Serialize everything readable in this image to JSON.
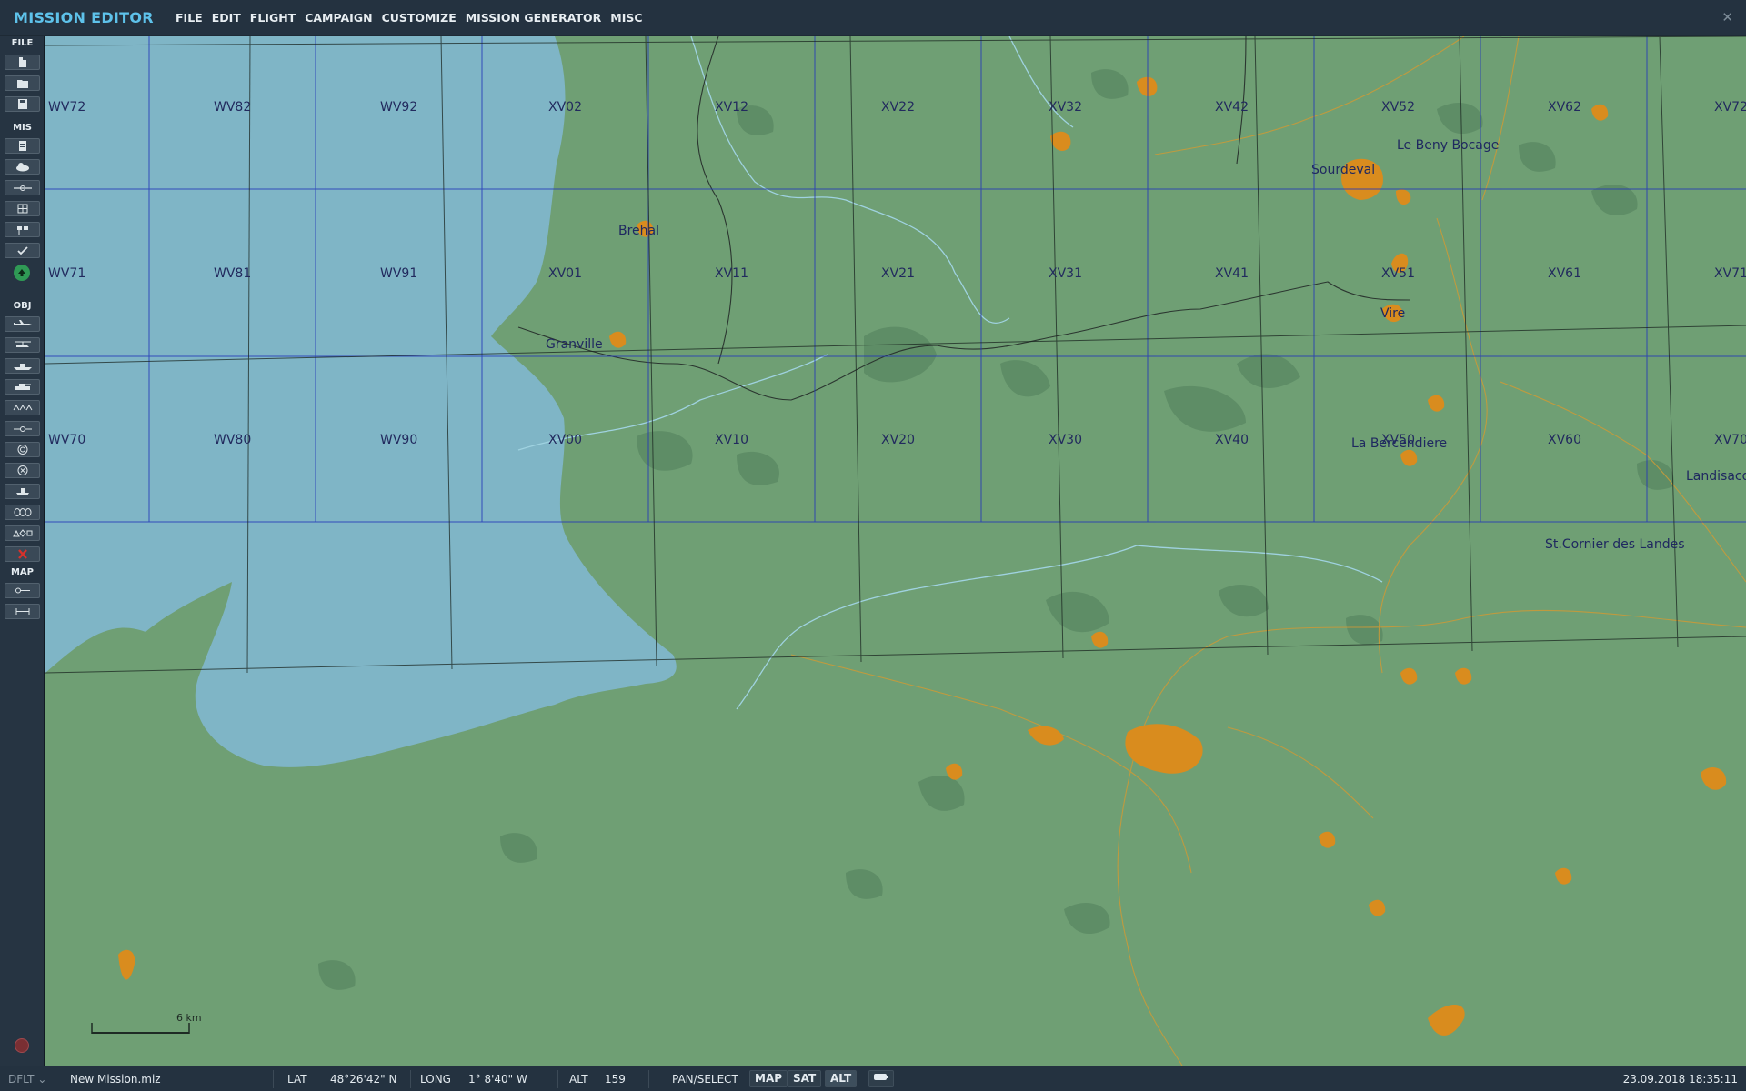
{
  "app": {
    "title": "MISSION EDITOR",
    "menu": [
      "FILE",
      "EDIT",
      "FLIGHT",
      "CAMPAIGN",
      "CUSTOMIZE",
      "MISSION GENERATOR",
      "MISC"
    ],
    "close_icon": "close-icon"
  },
  "sidebar": {
    "sections": {
      "file": "FILE",
      "mis": "MIS",
      "obj": "OBJ",
      "map": "MAP"
    },
    "file_buttons": [
      "new-file-icon",
      "open-file-icon",
      "save-file-icon"
    ],
    "mis_buttons": [
      "briefing-icon",
      "weather-icon",
      "trigger-zone-icon",
      "triggers-icon",
      "goals-icon",
      "check-icon",
      "go-icon"
    ],
    "obj_buttons": [
      "airplane-icon",
      "helicopter-icon",
      "ship-icon",
      "ground-unit-icon",
      "template-icon",
      "waypoint-icon",
      "target-icon",
      "static-object-icon",
      "cargo-icon",
      "zones-icon",
      "shapes-icon",
      "delete-icon"
    ],
    "map_buttons": [
      "map-options-icon",
      "ruler-icon"
    ]
  },
  "map": {
    "grid_labels": [
      [
        "WV72",
        "WV82",
        "WV92",
        "XV02",
        "XV12",
        "XV22",
        "XV32",
        "XV42",
        "XV52",
        "XV62",
        "XV72"
      ],
      [
        "WV71",
        "WV81",
        "WV91",
        "XV01",
        "XV11",
        "XV21",
        "XV31",
        "XV41",
        "XV51",
        "XV61",
        "XV71"
      ],
      [
        "WV70",
        "WV80",
        "WV90",
        "XV00",
        "XV10",
        "XV20",
        "XV30",
        "XV40",
        "XV50",
        "XV60",
        "XV70"
      ]
    ],
    "towns": [
      "Le Beny Bocage",
      "Sourdeval",
      "Brehal",
      "Vire",
      "Granville",
      "La Bercendiere",
      "Landisacq",
      "St.Cornier des Landes"
    ],
    "scale_label": "6 km",
    "colors": {
      "land": "#6f9f74",
      "sea": "#7fb5c6",
      "grid_blue": "#2438b8",
      "urban": "#d98c1e",
      "road": "#c89a3a",
      "river": "#9fd2e0"
    }
  },
  "status": {
    "profile": "DFLT",
    "mission_file": "New Mission.miz",
    "lat_label": "LAT",
    "lat_value": "48°26'42\" N",
    "long_label": "LONG",
    "long_value": "1° 8'40\" W",
    "alt_label": "ALT",
    "alt_value": "159",
    "mode": "PAN/SELECT",
    "view_buttons": [
      "MAP",
      "SAT",
      "ALT"
    ],
    "datetime": "23.09.2018 18:35:11"
  }
}
